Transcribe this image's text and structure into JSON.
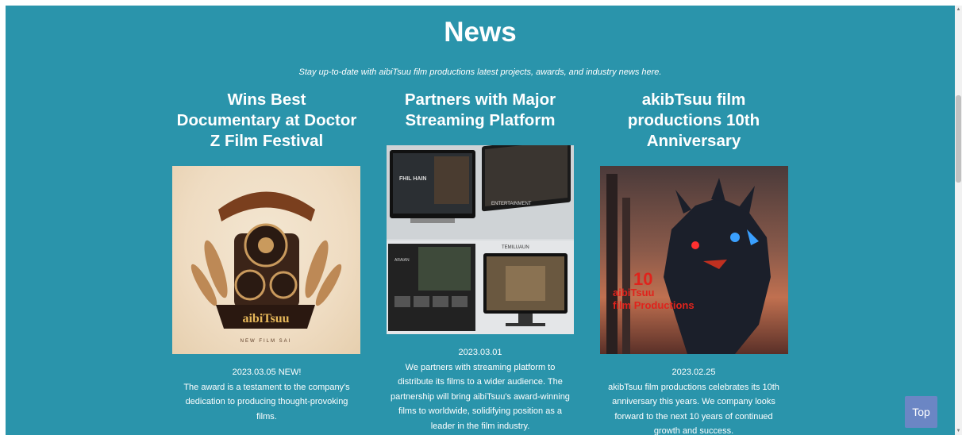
{
  "section": {
    "title": "News",
    "subtitle": "Stay up-to-date with aibiTsuu film productions latest projects, awards, and industry news here."
  },
  "cards": [
    {
      "title_lines": [
        "Wins Best",
        "Documentary at Doctor",
        "Z Film Festival"
      ],
      "date": "2023.03.05 NEW!",
      "body_lines": [
        "The award is a testament to the company's",
        "dedication to producing thought-provoking",
        "films."
      ],
      "image": {
        "logo_text": "aibiTsuu",
        "tag_text": "NEW FILM SAI"
      }
    },
    {
      "title_lines": [
        "Partners with Major",
        "Streaming Platform"
      ],
      "date": "2023.03.01",
      "body_lines": [
        "We partners with streaming platform to",
        "distribute its films to a wider audience. The",
        "partnership will bring aibiTsuu's award-winning",
        "films to worldwide, solidifying position as a",
        "leader in the film industry."
      ],
      "image": {
        "screen_text_1": "FHIL HAIN",
        "screen_text_2": "ENTERTAINMENT",
        "screen_text_3": "TEMILUAUN",
        "screen_text_4": "ARAIAN"
      }
    },
    {
      "title_lines": [
        "akibTsuu film",
        "productions 10th",
        "Anniversary"
      ],
      "date": "2023.02.25",
      "body_lines": [
        "akibTsuu film productions celebrates its 10th",
        "anniversary this years. We company looks",
        "forward to the next 10 years of continued",
        "growth and success."
      ],
      "image": {
        "big_number": "10",
        "overlay_line1": "aibiTsuu",
        "overlay_line2": "film Productions"
      }
    }
  ],
  "top_button": {
    "label": "Top"
  },
  "colors": {
    "background": "#2a94ab",
    "top_button": "#6b86c4",
    "overlay_red": "#e0231c"
  }
}
